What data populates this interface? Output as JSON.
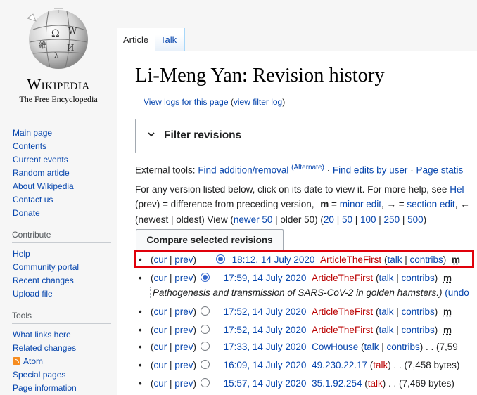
{
  "logo": {
    "wordmark": "Wikipedia",
    "tagline": "The Free Encyclopedia"
  },
  "sidebar": {
    "main": [
      "Main page",
      "Contents",
      "Current events",
      "Random article",
      "About Wikipedia",
      "Contact us",
      "Donate"
    ],
    "contribute_heading": "Contribute",
    "contribute": [
      "Help",
      "Community portal",
      "Recent changes",
      "Upload file"
    ],
    "tools_heading": "Tools",
    "tools": [
      "What links here",
      "Related changes",
      "Atom",
      "Special pages",
      "Page information"
    ]
  },
  "tabs": {
    "article": "Article",
    "talk": "Talk"
  },
  "page": {
    "title": "Li-Meng Yan: Revision history",
    "view_logs": "View logs for this page",
    "view_filter_log": "view filter log",
    "filter_label": "Filter revisions",
    "ext_tools_prefix": "External tools:",
    "ext_find_addition": "Find addition/removal",
    "ext_alternate": "(Alternate)",
    "ext_find_edits": "Find edits by user",
    "ext_page_stats": "Page statis",
    "help_text": "For any version listed below, click on its date to view it. For more help, see",
    "help_link": "Hel",
    "diff_prev": "(prev) = difference from preceding version,",
    "diff_m": "m",
    "diff_eq": "=",
    "diff_minor": "minor edit",
    "diff_arrow": ", → =",
    "diff_section": "section edit",
    "diff_tail": ", ←",
    "pager_newest": "(newest | oldest) View (",
    "pager_newer": "newer 50",
    "pager_older": " | older 50) (",
    "pager_counts": [
      "20",
      "50",
      "100",
      "250",
      "500"
    ],
    "compare_button": "Compare selected revisions",
    "summary_text": "Pathogenesis and transmission of SARS-CoV-2 in golden hamsters.)",
    "summary_undo": "(undo"
  },
  "revisions": [
    {
      "cur": "cur",
      "prev": "prev",
      "date": "18:12, 14 July 2020",
      "user": "ArticleTheFirst",
      "talk": "talk",
      "contribs": "contribs",
      "extra": "m",
      "radio": "on"
    },
    {
      "cur": "cur",
      "prev": "prev",
      "date": "17:59, 14 July 2020",
      "user": "ArticleTheFirst",
      "talk": "talk",
      "contribs": "contribs",
      "extra": "m",
      "radio": "none"
    },
    {
      "cur": "cur",
      "prev": "prev",
      "date": "17:52, 14 July 2020",
      "user": "ArticleTheFirst",
      "talk": "talk",
      "contribs": "contribs",
      "extra": "m",
      "radio": "off"
    },
    {
      "cur": "cur",
      "prev": "prev",
      "date": "17:52, 14 July 2020",
      "user": "ArticleTheFirst",
      "talk": "talk",
      "contribs": "contribs",
      "extra": "m",
      "radio": "off"
    },
    {
      "cur": "cur",
      "prev": "prev",
      "date": "17:33, 14 July 2020",
      "user": "CowHouse",
      "talk": "talk",
      "contribs": "contribs",
      "extra": ". . (7,59",
      "radio": "off",
      "user_blue": true
    },
    {
      "cur": "cur",
      "prev": "prev",
      "date": "16:09, 14 July 2020",
      "user": "49.230.22.17",
      "talk": "talk",
      "extra": ". . (7,458 bytes)",
      "radio": "off",
      "user_blue": true,
      "ip": true
    },
    {
      "cur": "cur",
      "prev": "prev",
      "date": "15:57, 14 July 2020",
      "user": "35.1.92.254",
      "talk": "talk",
      "extra": ". . (7,469 bytes)",
      "radio": "off",
      "user_blue": true,
      "ip": true
    }
  ],
  "colors": {
    "link": "#0645ad",
    "redlink": "#ba0000",
    "highlight": "#e0000a",
    "accent": "#3366cc"
  }
}
